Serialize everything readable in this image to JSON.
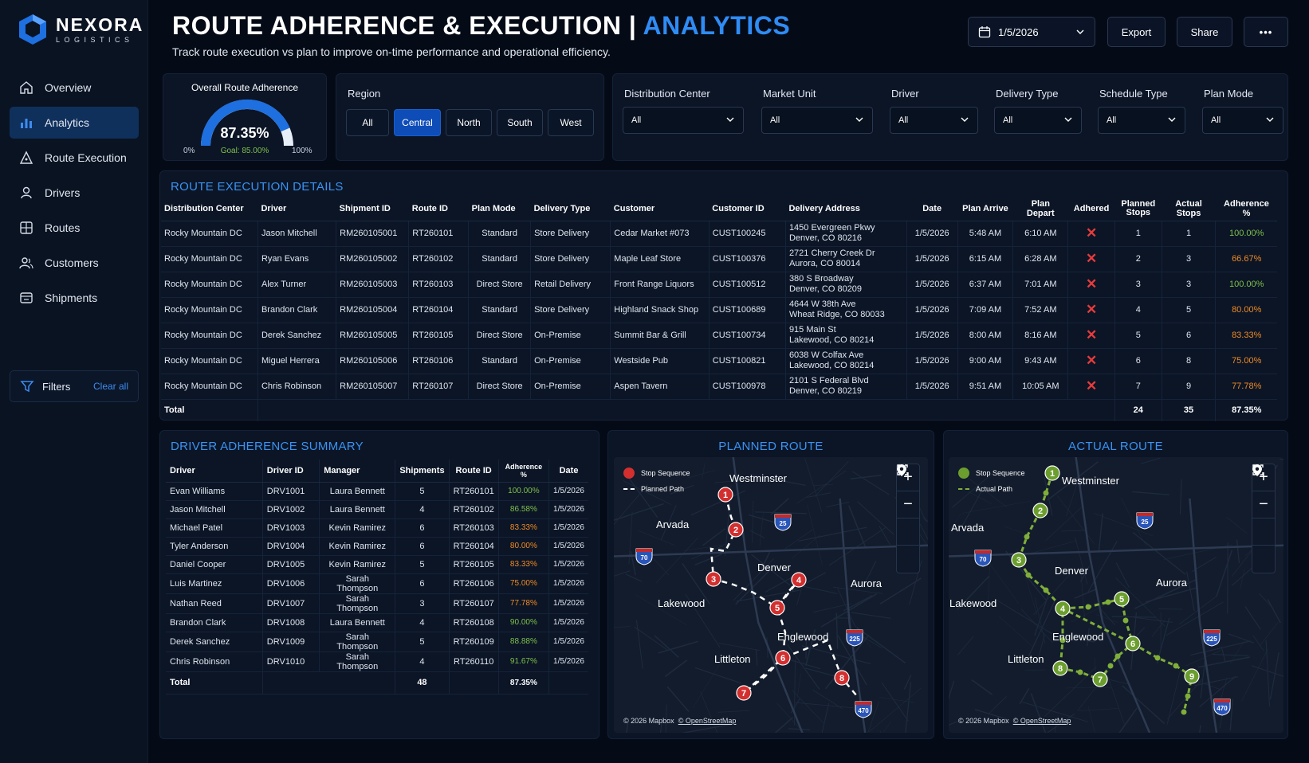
{
  "brand": {
    "name": "NEXORA",
    "sub": "LOGISTICS"
  },
  "nav": [
    {
      "label": "Overview",
      "icon": "home-icon"
    },
    {
      "label": "Analytics",
      "icon": "bar-chart-icon",
      "active": true
    },
    {
      "label": "Route Execution",
      "icon": "route-icon"
    },
    {
      "label": "Drivers",
      "icon": "driver-icon"
    },
    {
      "label": "Routes",
      "icon": "grid-icon"
    },
    {
      "label": "Customers",
      "icon": "customers-icon"
    },
    {
      "label": "Shipments",
      "icon": "box-icon"
    }
  ],
  "filters_box": {
    "label": "Filters",
    "clear": "Clear all"
  },
  "header": {
    "title": "ROUTE ADHERENCE & EXECUTION | ",
    "title_accent": "ANALYTICS",
    "subtitle": "Track route execution vs plan to improve on-time performance and operational efficiency.",
    "date": "1/5/2026",
    "export": "Export",
    "share": "Share",
    "more": "•••"
  },
  "gauge": {
    "title": "Overall Route Adherence",
    "value_label": "87.35%",
    "value": 0.8735,
    "goal": "Goal: 85.00%",
    "min": "0%",
    "max": "100%"
  },
  "region": {
    "label": "Region",
    "options": [
      "All",
      "Central",
      "North",
      "South",
      "West"
    ],
    "selected": "Central"
  },
  "dropdowns": [
    {
      "label": "Distribution Center",
      "value": "All"
    },
    {
      "label": "Market Unit",
      "value": "All"
    },
    {
      "label": "Driver",
      "value": "All"
    },
    {
      "label": "Delivery Type",
      "value": "All"
    },
    {
      "label": "Schedule Type",
      "value": "All"
    },
    {
      "label": "Plan Mode",
      "value": "All"
    }
  ],
  "route_details": {
    "title": "ROUTE EXECUTION DETAILS",
    "columns": [
      "Distribution Center",
      "Driver",
      "Shipment ID",
      "Route ID",
      "Plan Mode",
      "Delivery Type",
      "Customer",
      "Customer ID",
      "Delivery Address",
      "Date",
      "Plan Arrive",
      "Plan Depart",
      "Adhered",
      "Planned Stops",
      "Actual Stops",
      "Adherence %"
    ],
    "rows": [
      [
        "Rocky Mountain DC",
        "Jason Mitchell",
        "RM260105001",
        "RT260101",
        "Standard",
        "Store Delivery",
        "Cedar Market #073",
        "CUST100245",
        "1450 Evergreen Pkwy",
        "Denver, CO 80216",
        "1/5/2026",
        "5:48 AM",
        "6:10 AM",
        "1",
        "1",
        "100.00%"
      ],
      [
        "Rocky Mountain DC",
        "Ryan Evans",
        "RM260105002",
        "RT260102",
        "Standard",
        "Store Delivery",
        "Maple Leaf Store",
        "CUST100376",
        "2721 Cherry Creek Dr",
        "Aurora, CO 80014",
        "1/5/2026",
        "6:15 AM",
        "6:28 AM",
        "2",
        "3",
        "66.67%"
      ],
      [
        "Rocky Mountain DC",
        "Alex Turner",
        "RM260105003",
        "RT260103",
        "Direct Store",
        "Retail Delivery",
        "Front Range Liquors",
        "CUST100512",
        "380 S Broadway",
        "Denver, CO 80209",
        "1/5/2026",
        "6:37 AM",
        "7:01 AM",
        "3",
        "3",
        "100.00%"
      ],
      [
        "Rocky Mountain DC",
        "Brandon Clark",
        "RM260105004",
        "RT260104",
        "Standard",
        "Store Delivery",
        "Highland Snack Shop",
        "CUST100689",
        "4644 W 38th Ave",
        "Wheat Ridge, CO 80033",
        "1/5/2026",
        "7:09 AM",
        "7:52 AM",
        "4",
        "5",
        "80.00%"
      ],
      [
        "Rocky Mountain DC",
        "Derek Sanchez",
        "RM260105005",
        "RT260105",
        "Direct Store",
        "On-Premise",
        "Summit Bar & Grill",
        "CUST100734",
        "915 Main St",
        "Lakewood, CO 80214",
        "1/5/2026",
        "8:00 AM",
        "8:16 AM",
        "5",
        "6",
        "83.33%"
      ],
      [
        "Rocky Mountain DC",
        "Miguel Herrera",
        "RM260105006",
        "RT260106",
        "Standard",
        "On-Premise",
        "Westside Pub",
        "CUST100821",
        "6038 W Colfax Ave",
        "Lakewood, CO 80214",
        "1/5/2026",
        "9:00 AM",
        "9:43 AM",
        "6",
        "8",
        "75.00%"
      ],
      [
        "Rocky Mountain DC",
        "Chris Robinson",
        "RM260105007",
        "RT260107",
        "Direct Store",
        "On-Premise",
        "Aspen Tavern",
        "CUST100978",
        "2101 S Federal Blvd",
        "Denver, CO 80219",
        "1/5/2026",
        "9:51 AM",
        "10:05 AM",
        "7",
        "9",
        "77.78%"
      ]
    ],
    "total": {
      "label": "Total",
      "planned": "24",
      "actual": "35",
      "pct": "87.35%"
    }
  },
  "driver_summary": {
    "title": "DRIVER ADHERENCE SUMMARY",
    "columns": [
      "Driver",
      "Driver ID",
      "Manager",
      "Shipments",
      "Route ID",
      "Adherence %",
      "Date"
    ],
    "rows": [
      [
        "Evan Williams",
        "DRV1001",
        "Laura Bennett",
        "5",
        "RT260101",
        "100.00%",
        "1/5/2026"
      ],
      [
        "Jason Mitchell",
        "DRV1002",
        "Laura Bennett",
        "4",
        "RT260102",
        "86.58%",
        "1/5/2026"
      ],
      [
        "Michael Patel",
        "DRV1003",
        "Kevin Ramirez",
        "6",
        "RT260103",
        "83.33%",
        "1/5/2026"
      ],
      [
        "Tyler Anderson",
        "DRV1004",
        "Kevin Ramirez",
        "6",
        "RT260104",
        "80.00%",
        "1/5/2026"
      ],
      [
        "Daniel Cooper",
        "DRV1005",
        "Kevin Ramirez",
        "5",
        "RT260105",
        "83.33%",
        "1/5/2026"
      ],
      [
        "Luis Martinez",
        "DRV1006",
        "Sarah Thompson",
        "6",
        "RT260106",
        "75.00%",
        "1/5/2026"
      ],
      [
        "Nathan Reed",
        "DRV1007",
        "Sarah Thompson",
        "3",
        "RT260107",
        "77.78%",
        "1/5/2026"
      ],
      [
        "Brandon Clark",
        "DRV1008",
        "Laura Bennett",
        "4",
        "RT260108",
        "90.00%",
        "1/5/2026"
      ],
      [
        "Derek Sanchez",
        "DRV1009",
        "Sarah Thompson",
        "5",
        "RT260109",
        "88.88%",
        "1/5/2026"
      ],
      [
        "Chris Robinson",
        "DRV1010",
        "Sarah Thompson",
        "4",
        "RT260110",
        "91.67%",
        "1/5/2026"
      ]
    ],
    "total": {
      "label": "Total",
      "shipments": "48",
      "pct": "87.35%"
    }
  },
  "planned_map": {
    "title": "PLANNED ROUTE",
    "legend_stop": "Stop Sequence",
    "legend_path": "Planned Path",
    "stops": [
      "1",
      "2",
      "3",
      "4",
      "5",
      "6",
      "7",
      "8"
    ],
    "color": "#d32f2f"
  },
  "actual_map": {
    "title": "ACTUAL ROUTE",
    "legend_stop": "Stop Sequence",
    "legend_path": "Actual Path",
    "stops": [
      "1",
      "2",
      "3",
      "4",
      "5",
      "6",
      "7",
      "8",
      "9"
    ],
    "color": "#6b9e2e"
  },
  "map_labels": {
    "westminster": "Westminster",
    "arvada": "Arvada",
    "denver": "Denver",
    "aurora": "Aurora",
    "lakewood": "Lakewood",
    "englewood": "Englewood",
    "littleton": "Littleton"
  },
  "highways": {
    "i25": "25",
    "i70": "70",
    "i225": "225",
    "i470": "470"
  },
  "map_credit": {
    "mapbox": "© 2026 Mapbox",
    "osm": "© OpenStreetMap"
  },
  "zoom": {
    "plus": "+",
    "minus": "−"
  }
}
